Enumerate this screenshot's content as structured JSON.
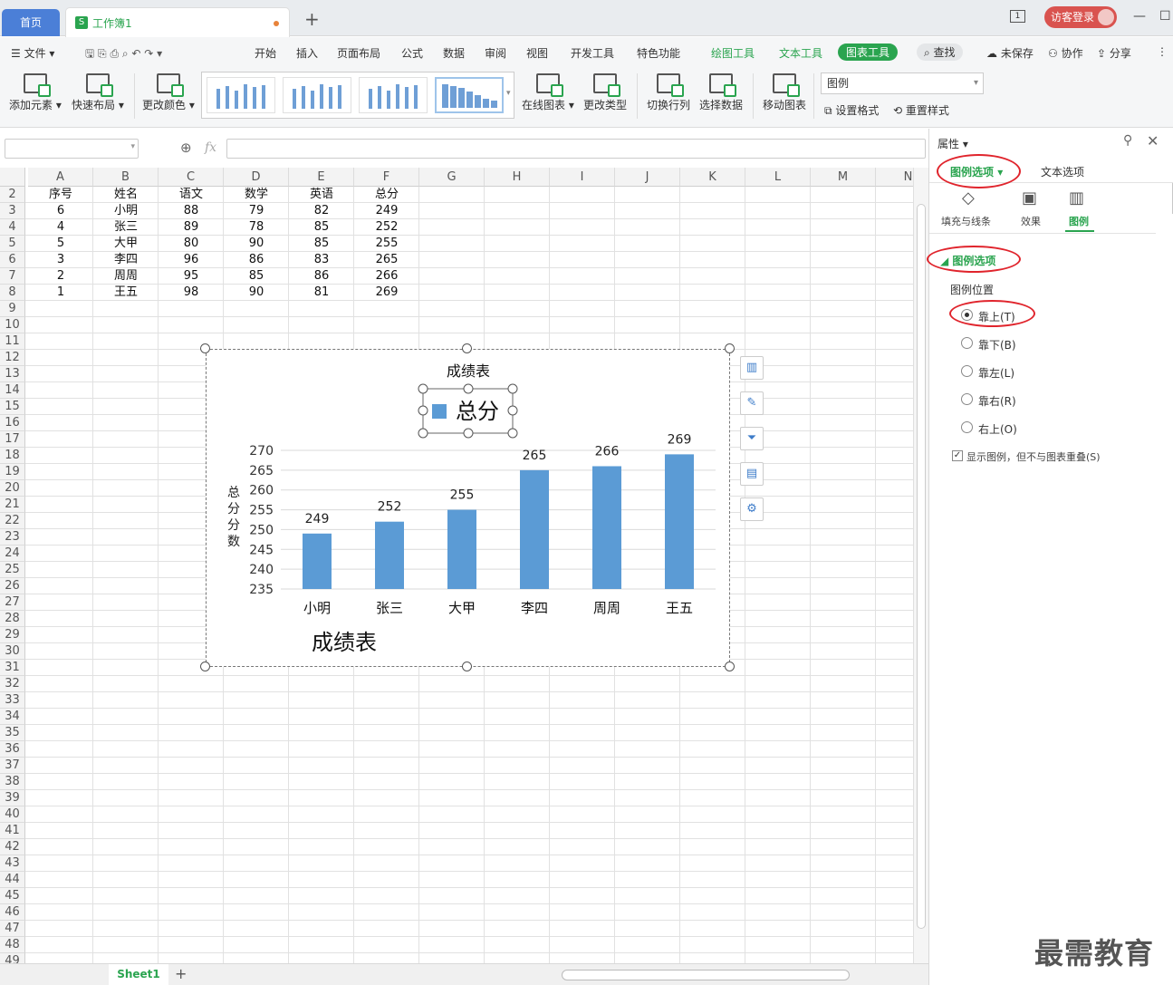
{
  "titlebar": {
    "home_tab": "首页",
    "workbook_tab": "工作簿1",
    "new_tab": "+",
    "guest_login": "访客登录",
    "page_indicator": "1"
  },
  "menu": {
    "file": "文件",
    "items": [
      "开始",
      "插入",
      "页面布局",
      "公式",
      "数据",
      "审阅",
      "视图",
      "开发工具",
      "特色功能"
    ],
    "drawing_tools": "绘图工具",
    "text_tools": "文本工具",
    "chart_tools": "图表工具",
    "search": "查找",
    "unsaved": "未保存",
    "collaborate": "协作",
    "share": "分享"
  },
  "ribbon": {
    "add_element": "添加元素",
    "quick_layout": "快速布局",
    "change_color": "更改颜色",
    "online_chart": "在线图表",
    "change_type": "更改类型",
    "switch_rowcol": "切换行列",
    "select_data": "选择数据",
    "move_chart": "移动图表",
    "element_select": "图例",
    "set_format": "设置格式",
    "reset_style": "重置样式"
  },
  "formula": {
    "fx": "fx",
    "value": ""
  },
  "sheet": {
    "columns": [
      "A",
      "B",
      "C",
      "D",
      "E",
      "F",
      "G",
      "H",
      "I",
      "J",
      "K",
      "L",
      "M",
      "N"
    ],
    "rows": [
      2,
      3,
      4,
      5,
      6,
      7,
      8,
      9,
      10,
      11,
      12,
      13,
      14,
      15,
      16,
      17,
      18,
      19,
      20,
      21,
      22,
      23,
      24,
      25,
      26,
      27,
      28,
      29,
      30,
      31,
      32,
      33,
      34,
      35,
      36,
      37,
      38,
      39,
      40,
      41,
      42,
      43,
      44,
      45,
      46,
      47,
      48,
      49
    ],
    "table": [
      [
        "序号",
        "姓名",
        "语文",
        "数学",
        "英语",
        "总分"
      ],
      [
        "6",
        "小明",
        "88",
        "79",
        "82",
        "249"
      ],
      [
        "4",
        "张三",
        "89",
        "78",
        "85",
        "252"
      ],
      [
        "5",
        "大甲",
        "80",
        "90",
        "85",
        "255"
      ],
      [
        "3",
        "李四",
        "96",
        "86",
        "83",
        "265"
      ],
      [
        "2",
        "周周",
        "95",
        "85",
        "86",
        "266"
      ],
      [
        "1",
        "王五",
        "98",
        "90",
        "81",
        "269"
      ]
    ],
    "tab": "Sheet1"
  },
  "chart_data": {
    "type": "bar",
    "title": "成绩表",
    "bottom_title": "成绩表",
    "legend": "总分",
    "legend_position": "top",
    "ylabel": "总分分数",
    "categories": [
      "小明",
      "张三",
      "大甲",
      "李四",
      "周周",
      "王五"
    ],
    "series": [
      {
        "name": "总分",
        "values": [
          249,
          252,
          255,
          265,
          266,
          269
        ]
      }
    ],
    "ylim": [
      235,
      270
    ],
    "yticks": [
      270,
      265,
      260,
      255,
      250,
      245,
      240,
      235
    ],
    "bar_color": "#5b9bd5",
    "grid": true
  },
  "panel": {
    "title": "属性",
    "tab_legend_options": "图例选项",
    "tab_text_options": "文本选项",
    "sub_fill": "填充与线条",
    "sub_effect": "效果",
    "sub_legend": "图例",
    "section": "图例选项",
    "position_label": "图例位置",
    "positions": [
      "靠上(T)",
      "靠下(B)",
      "靠左(L)",
      "靠右(R)",
      "右上(O)"
    ],
    "selected_position": "靠上(T)",
    "overlap_checkbox": "显示图例，但不与图表重叠(S)",
    "overlap_checked": true
  },
  "watermark": "最需教育",
  "colors": {
    "accent": "#2aa44f",
    "home_tab": "#4b7fd7",
    "annotation": "#e0242c"
  }
}
